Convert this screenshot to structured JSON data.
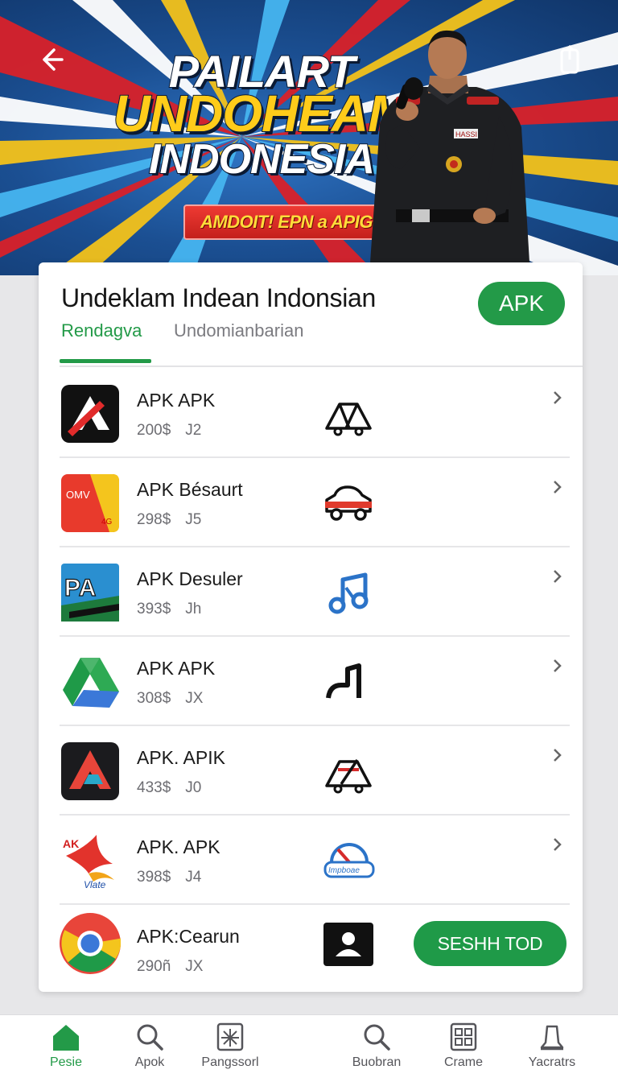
{
  "hero": {
    "title_line1": "PAILART",
    "title_line2": "UNDOHEAM",
    "title_line3": "INDONESIA",
    "cta_label": "AMDOIT! EPN a APIG",
    "badge_text": "HASSI"
  },
  "card": {
    "title": "Undeklam Indean Indonsian",
    "badge_label": "APK",
    "tabs": [
      {
        "label": "Rendagva",
        "active": true
      },
      {
        "label": "Undomianbarian",
        "active": false
      }
    ]
  },
  "apps": [
    {
      "name": "APK APK",
      "size": "200$",
      "rating": "J2",
      "icon": "delta-a-icon",
      "glyph": "tent-outline-icon"
    },
    {
      "name": "APK Bésaurt",
      "size": "298$",
      "rating": "J5",
      "icon": "red-yellow-tile-icon",
      "glyph": "car-icon",
      "icon_text_top": "OMV",
      "icon_text_bottom": "4G"
    },
    {
      "name": "APK Desuler",
      "size": "393$",
      "rating": "Jh",
      "icon": "pa-logo-icon",
      "glyph": "music-note-icon",
      "icon_text": "PA"
    },
    {
      "name": "APK APK",
      "size": "308$",
      "rating": "JX",
      "icon": "google-drive-icon",
      "glyph": "stair-step-icon"
    },
    {
      "name": "APK. APIK",
      "size": "433$",
      "rating": "J0",
      "icon": "dark-delta-icon",
      "glyph": "tent-slash-icon"
    },
    {
      "name": "APK. APK",
      "size": "398$",
      "rating": "J4",
      "icon": "bird-logo-icon",
      "glyph": "speedometer-icon",
      "icon_text_top": "AK",
      "icon_text_bottom": "Vlate",
      "glyph_text": "Impboae"
    },
    {
      "name": "APK:Cearun",
      "size": "290ñ",
      "rating": "JX",
      "icon": "chrome-icon",
      "glyph": "contact-card-icon",
      "action_label": "SESHH TOD"
    }
  ],
  "bottom_nav": [
    {
      "label": "Pesie",
      "icon": "home-icon",
      "active": true
    },
    {
      "label": "Apok",
      "icon": "search-icon",
      "active": false
    },
    {
      "label": "Pangssorl",
      "icon": "puzzle-icon",
      "active": false
    },
    {
      "label": "Buobran",
      "icon": "search-icon",
      "active": false
    },
    {
      "label": "Crame",
      "icon": "grid-icon",
      "active": false
    },
    {
      "label": "Yacratrs",
      "icon": "bell-icon",
      "active": false
    }
  ],
  "colors": {
    "accent_green": "#239a48",
    "hero_blue": "#1b4f92",
    "hero_yellow": "#ffcc1a",
    "cta_red": "#d4261f"
  }
}
